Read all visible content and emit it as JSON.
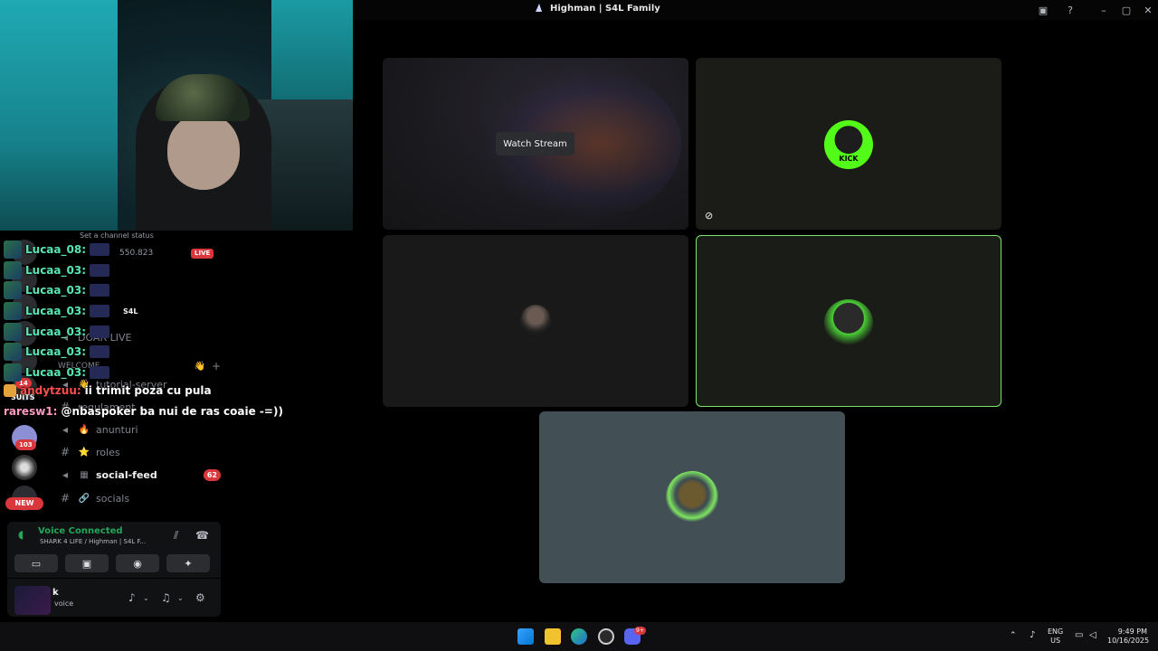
{
  "window": {
    "title": "Highman | S4L Family"
  },
  "voice_grid": {
    "watch_stream_label": "Watch Stream",
    "tile_kick_text": "KICK"
  },
  "chat": {
    "lines": [
      {
        "user": "Lucaa_08:",
        "msg": "",
        "color": "teal"
      },
      {
        "user": "Lucaa_03:",
        "msg": "",
        "color": "teal"
      },
      {
        "user": "Lucaa_03:",
        "msg": "",
        "color": "teal"
      },
      {
        "user": "Lucaa_03:",
        "msg": "",
        "color": "teal"
      },
      {
        "user": "Lucaa_03:",
        "msg": "",
        "color": "teal"
      },
      {
        "user": "Lucaa_03:",
        "msg": "",
        "color": "teal"
      },
      {
        "user": "Lucaa_03:",
        "msg": "",
        "color": "teal"
      },
      {
        "user": "andytzuu:",
        "msg": "ii trimit poza cu pula",
        "color": "red"
      },
      {
        "user": "raresw1:",
        "msg": "@nbaspoker ba nui de ras coaie -=))",
        "color": "pink"
      }
    ]
  },
  "profile_overlay": {
    "count": "550.823",
    "live": "LIVE",
    "server_short": "S4L",
    "channel_status": "Set a channel status"
  },
  "channels": {
    "items": [
      {
        "name": "DOAR LIVE",
        "emoji": "",
        "unread": false,
        "badge": ""
      },
      {
        "name": "WELCOME",
        "emoji": "👋",
        "unread": false,
        "badge": ""
      },
      {
        "name": "tutorial-server",
        "emoji": "👋",
        "unread": false,
        "badge": ""
      },
      {
        "name": "regulament",
        "emoji": "",
        "unread": false,
        "badge": ""
      },
      {
        "name": "anunturi",
        "emoji": "🔥",
        "unread": false,
        "badge": ""
      },
      {
        "name": "roles",
        "emoji": "⭐",
        "unread": false,
        "badge": ""
      },
      {
        "name": "social-feed",
        "emoji": "▦",
        "unread": true,
        "badge": "62"
      },
      {
        "name": "socials",
        "emoji": "🔗",
        "unread": false,
        "badge": ""
      }
    ]
  },
  "rail": {
    "badge_103": "103",
    "badge_14": "14",
    "new_label": "NEW",
    "suits_label": "SUITS"
  },
  "voice_panel": {
    "status": "Voice Connected",
    "location": "SHARK 4 LIFE / Highman | S4L F..."
  },
  "user_panel": {
    "name": "k",
    "status": "voice"
  },
  "taskbar": {
    "lang_top": "ENG",
    "lang_bottom": "US",
    "time": "9:49 PM",
    "date": "10/16/2025",
    "discord_badge": "9+"
  },
  "colors": {
    "accent_green": "#23a55a",
    "speaking_border": "#7be36a",
    "kick_green": "#53fc18",
    "badge_red": "#da373c"
  }
}
